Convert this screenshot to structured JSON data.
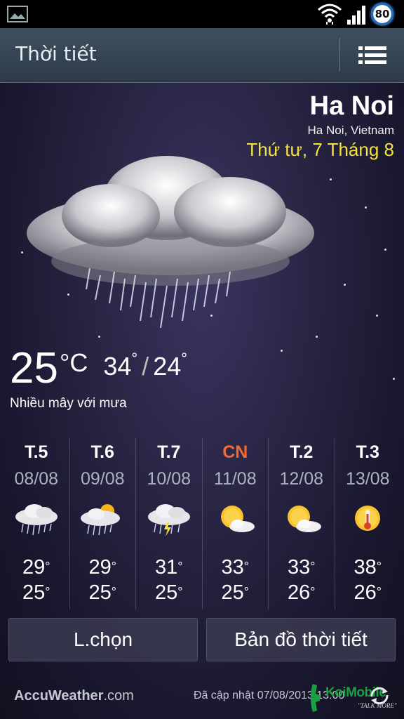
{
  "status_bar": {
    "battery_level": "80",
    "icons": [
      "gallery-icon",
      "wifi-icon",
      "signal-icon",
      "battery-icon"
    ]
  },
  "app_bar": {
    "title": "Thời tiết",
    "menu_icon": "menu-list-icon"
  },
  "location": {
    "city": "Ha Noi",
    "region": "Ha Noi, Vietnam",
    "date": "Thứ tư, 7 Tháng 8"
  },
  "current": {
    "icon": "cloud-rain-icon",
    "temp": "25",
    "unit": "C",
    "high": "34",
    "low": "24",
    "condition": "Nhiều mây với mưa"
  },
  "forecast": [
    {
      "day": "T.5",
      "date": "08/08",
      "icon": "cloud-rain-icon",
      "high": "29",
      "low": "25"
    },
    {
      "day": "T.6",
      "date": "09/08",
      "icon": "sun-cloud-rain-icon",
      "high": "29",
      "low": "25"
    },
    {
      "day": "T.7",
      "date": "10/08",
      "icon": "cloud-thunder-icon",
      "high": "31",
      "low": "25"
    },
    {
      "day": "CN",
      "date": "11/08",
      "icon": "sun-cloud-icon",
      "high": "33",
      "low": "25"
    },
    {
      "day": "T.2",
      "date": "12/08",
      "icon": "sun-cloud-icon",
      "high": "33",
      "low": "26"
    },
    {
      "day": "T.3",
      "date": "13/08",
      "icon": "sun-hot-icon",
      "high": "38",
      "low": "26"
    }
  ],
  "buttons": {
    "options": "L.chọn",
    "map": "Bản đồ thời tiết"
  },
  "footer": {
    "brand": "AccuWeather",
    "brand_suffix": ".com",
    "updated": "Đã cập nhật 07/08/2013 13:00",
    "watermark": "KoiMobile",
    "watermark_sub": "\"TALK MORE\""
  },
  "colors": {
    "date_accent": "#f6e33a",
    "sunday": "#f36a2a",
    "app_bar": "#36444f"
  }
}
